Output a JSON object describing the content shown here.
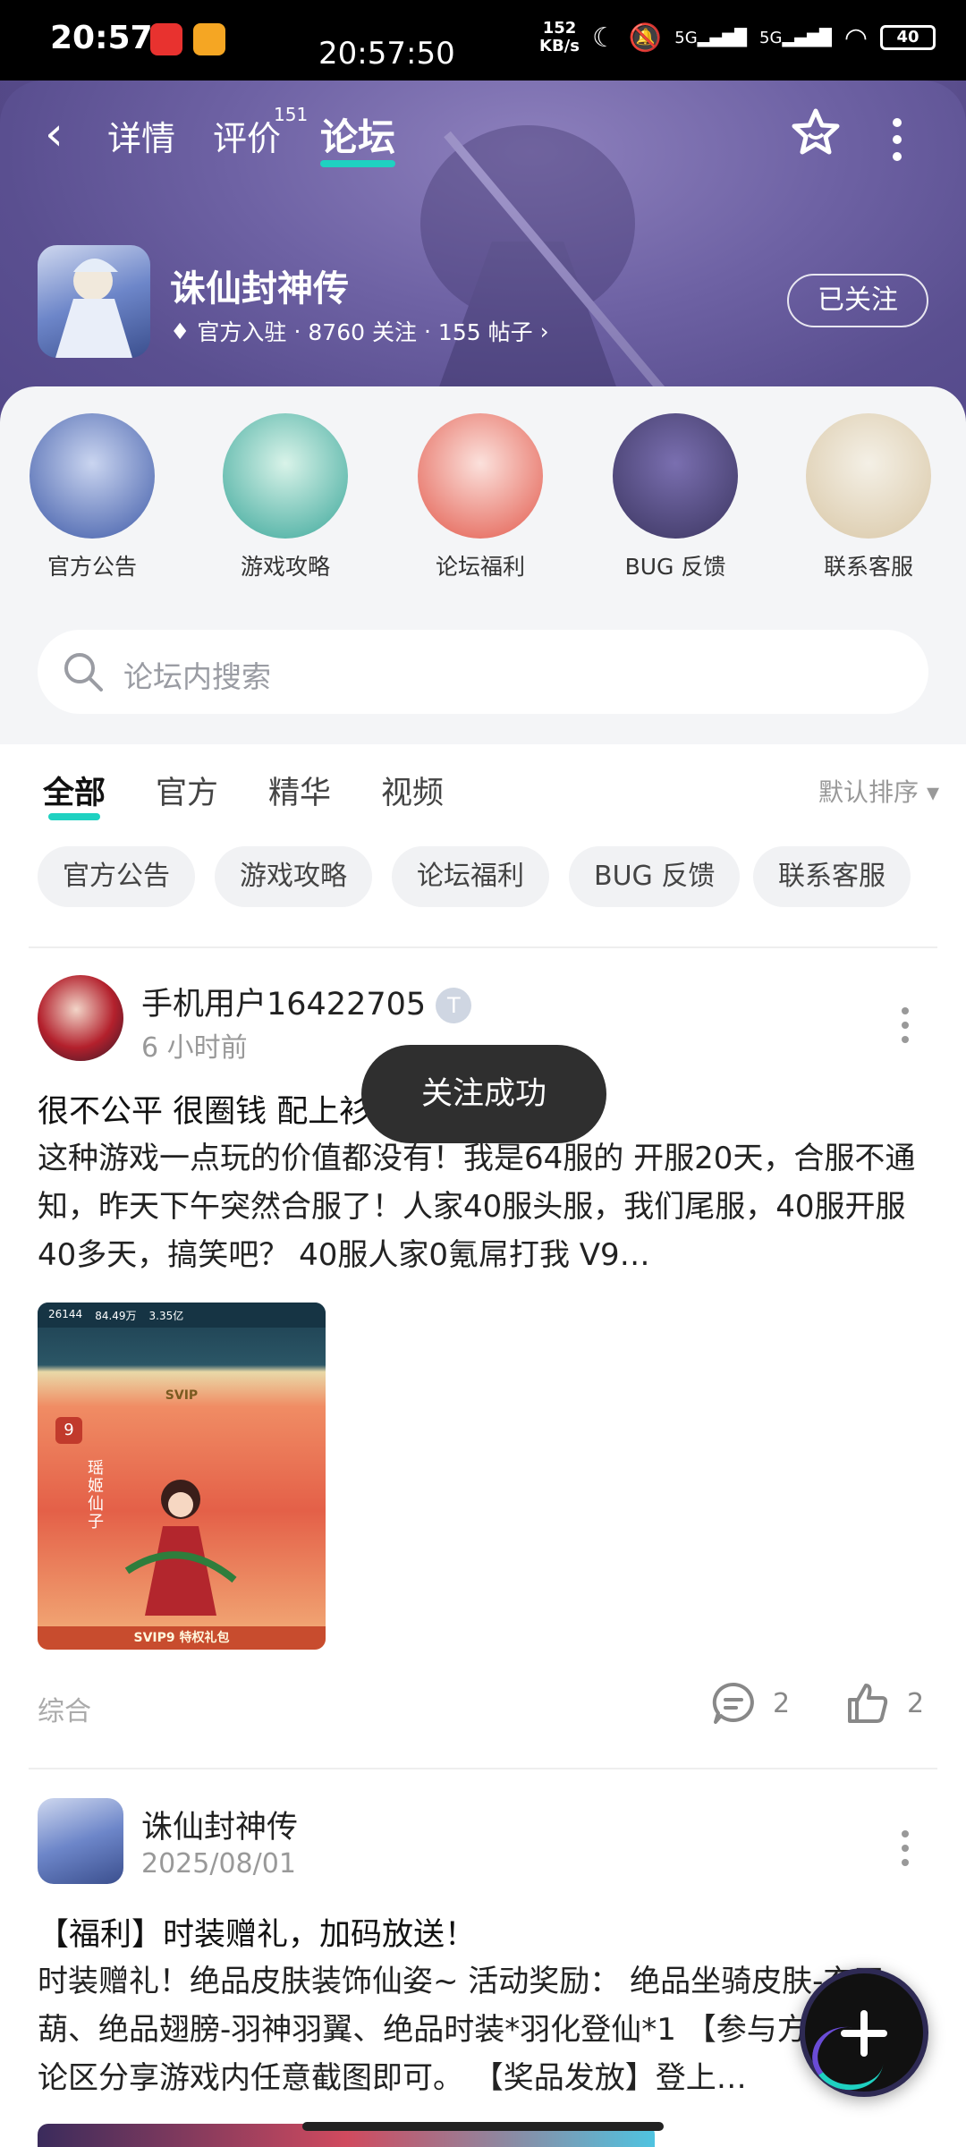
{
  "status_bar": {
    "time": "20:57",
    "overlay_time": "20:57:50",
    "net_speed_value": "152",
    "net_speed_unit": "KB/s",
    "signal_1": "5G",
    "signal_2": "5G",
    "battery": "40"
  },
  "top_nav": {
    "tabs": [
      {
        "label": "详情"
      },
      {
        "label": "评价",
        "badge": "151"
      },
      {
        "label": "论坛"
      }
    ],
    "active_tab": "论坛"
  },
  "game": {
    "title": "诛仙封神传",
    "official": "官方入驻",
    "followers": "8760 关注",
    "posts": "155 帖子",
    "follow_button": "已关注"
  },
  "categories": [
    {
      "label": "官方公告",
      "color": "#3e5aa8"
    },
    {
      "label": "游戏攻略",
      "color": "#3aa79a"
    },
    {
      "label": "论坛福利",
      "color": "#e35a4c"
    },
    {
      "label": "BUG 反馈",
      "color": "#3b3560"
    },
    {
      "label": "联系客服",
      "color": "#d9c7a6"
    }
  ],
  "search": {
    "placeholder": "论坛内搜索"
  },
  "filter_tabs": [
    "全部",
    "官方",
    "精华",
    "视频"
  ],
  "sort_label": "默认排序",
  "chips": [
    "官方公告",
    "游戏攻略",
    "论坛福利",
    "BUG 反馈",
    "联系客服"
  ],
  "posts": [
    {
      "user": "手机用户16422705",
      "time": "6 小时前",
      "title": "很不公平 很圈钱 配上衫",
      "body": "这种游戏一点玩的价值都没有！我是64服的 开服20天，合服不通知，昨天下午突然合服了！人家40服头服，我们尾服，40服开服40多天，搞笑吧？ 40服人家0氪屌打我 V9…",
      "tag": "综合",
      "comments": "2",
      "likes": "2",
      "image": {
        "resource_1": "26144",
        "resource_2": "84.49万",
        "resource_3": "3.35亿",
        "level_title": "SVIP",
        "level": "9",
        "banner": "SVIP9 特权礼包",
        "char_name": "瑶姬仙子"
      }
    },
    {
      "user": "诛仙封神传",
      "time": "2025/08/01",
      "title": "【福利】时装赠礼，加码放送！",
      "body": "时装赠礼！绝品皮肤装饰仙姿~ 活动奖励： 绝品坐骑皮肤-玄天葫、绝品翅膀-羽神羽翼、绝品时装*羽化登仙*1 【参与方式】 评论区分享游戏内任意截图即可。 【奖品发放】登上…"
    }
  ],
  "toast": "关注成功",
  "colors": {
    "accent": "#1fd1c1",
    "hero": "#6a5d9e"
  }
}
